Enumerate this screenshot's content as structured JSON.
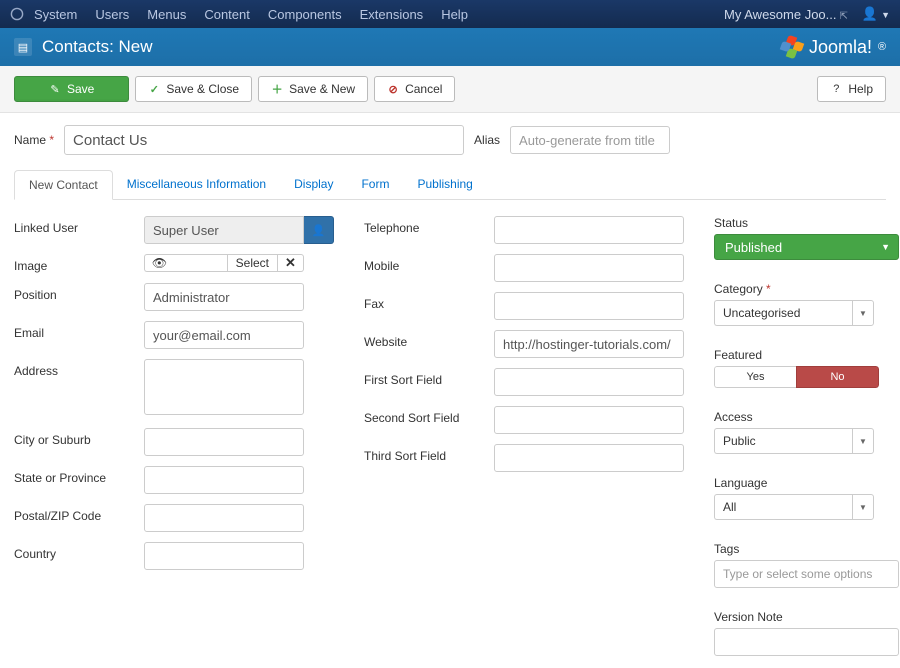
{
  "topmenu": {
    "items": [
      "System",
      "Users",
      "Menus",
      "Content",
      "Components",
      "Extensions",
      "Help"
    ],
    "site": "My Awesome Joo..."
  },
  "titlebar": {
    "title": "Contacts: New",
    "brand": "Joomla!"
  },
  "toolbar": {
    "save": "Save",
    "saveclose": "Save & Close",
    "savenew": "Save & New",
    "cancel": "Cancel",
    "help": "Help"
  },
  "namefield": {
    "label": "Name",
    "value": "Contact Us"
  },
  "aliasfield": {
    "label": "Alias",
    "placeholder": "Auto-generate from title"
  },
  "tabs": [
    "New Contact",
    "Miscellaneous Information",
    "Display",
    "Form",
    "Publishing"
  ],
  "left": {
    "linked_user": {
      "label": "Linked User",
      "value": "Super User"
    },
    "image": {
      "label": "Image",
      "select": "Select"
    },
    "position": {
      "label": "Position",
      "value": "Administrator"
    },
    "email": {
      "label": "Email",
      "value": "your@email.com"
    },
    "address": {
      "label": "Address"
    },
    "city": {
      "label": "City or Suburb"
    },
    "state": {
      "label": "State or Province"
    },
    "postal": {
      "label": "Postal/ZIP Code"
    },
    "country": {
      "label": "Country"
    }
  },
  "mid": {
    "telephone": {
      "label": "Telephone"
    },
    "mobile": {
      "label": "Mobile"
    },
    "fax": {
      "label": "Fax"
    },
    "website": {
      "label": "Website",
      "value": "http://hostinger-tutorials.com/"
    },
    "sort1": {
      "label": "First Sort Field"
    },
    "sort2": {
      "label": "Second Sort Field"
    },
    "sort3": {
      "label": "Third Sort Field"
    }
  },
  "right": {
    "status": {
      "label": "Status",
      "value": "Published"
    },
    "category": {
      "label": "Category",
      "value": "Uncategorised"
    },
    "featured": {
      "label": "Featured",
      "yes": "Yes",
      "no": "No"
    },
    "access": {
      "label": "Access",
      "value": "Public"
    },
    "language": {
      "label": "Language",
      "value": "All"
    },
    "tags": {
      "label": "Tags",
      "placeholder": "Type or select some options"
    },
    "version": {
      "label": "Version Note"
    }
  }
}
